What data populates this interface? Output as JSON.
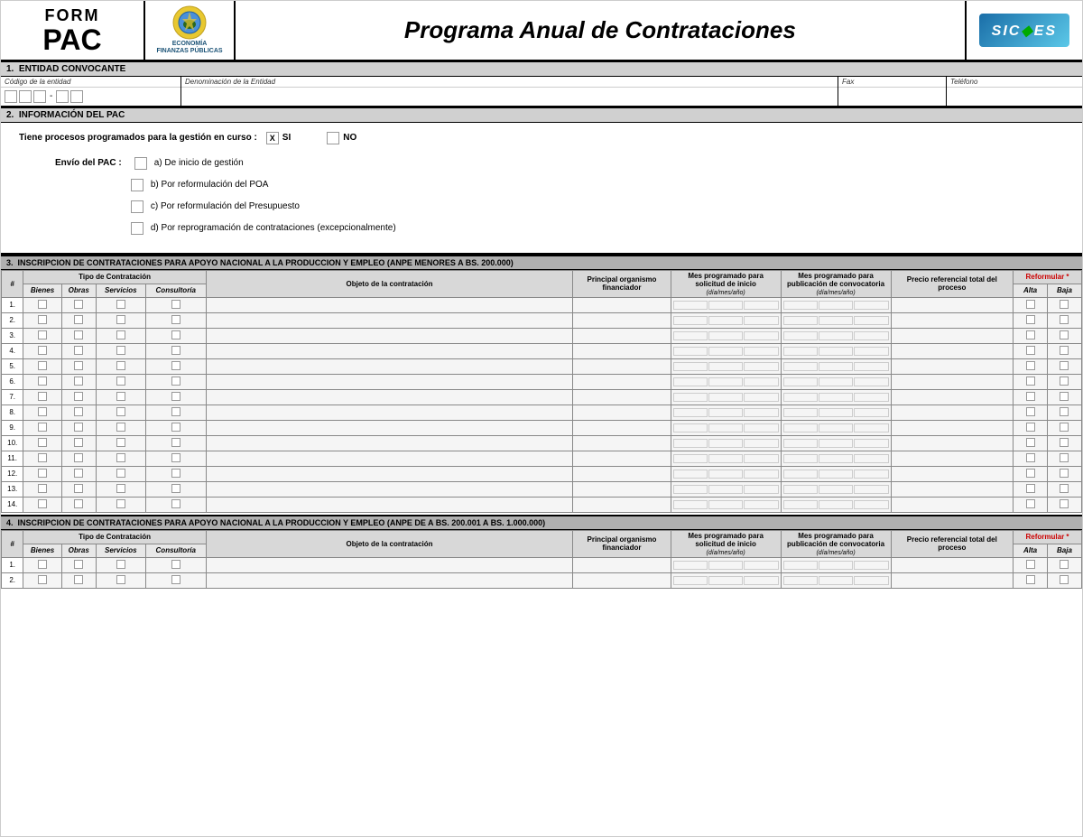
{
  "header": {
    "form_label": "FORM",
    "pac_label": "PAC",
    "ministry_line1": "ECONOMÍA",
    "ministry_line2": "FINANZAS PÚBLICAS",
    "title": "Programa Anual de Contrataciones",
    "sicoes": "SIC◆ES"
  },
  "section1": {
    "number": "1.",
    "title": "ENTIDAD CONVOCANTE",
    "codigo_label": "Código de la entidad",
    "denominacion_label": "Denominación de la Entidad",
    "fax_label": "Fax",
    "telefono_label": "Teléfono"
  },
  "section2": {
    "number": "2.",
    "title": "INFORMACIÓN DEL PAC",
    "question": "Tiene procesos programados para la gestión en curso  :",
    "si_label": "SI",
    "no_label": "NO",
    "si_checked": true,
    "no_checked": false,
    "envio_label": "Envío del PAC :",
    "options": [
      "a)  De inicio de gestión",
      "b)  Por reformulación del POA",
      "c)  Por reformulación del Presupuesto",
      "d)  Por reprogramación de contrataciones (excepcionalmente)"
    ]
  },
  "section3": {
    "number": "3.",
    "title": "INSCRIPCION DE CONTRATACIONES PARA APOYO NACIONAL A LA PRODUCCION Y EMPLEO (ANPE MENORES A BS. 200.000)",
    "tipo_label": "Tipo de Contratación",
    "tipo_sub": [
      "Bienes",
      "Obras",
      "Servicios",
      "Consultoría"
    ],
    "objeto_label": "Objeto de la contratación",
    "organismo_label": "Principal organismo financiador",
    "solicitud_label": "Mes programado para solicitud de inicio",
    "solicitud_sub": "(día/mes/año)",
    "publicacion_label": "Mes programado para publicación de convocatoria",
    "publicacion_sub": "(día/mes/año)",
    "precio_label": "Precio referencial total del proceso",
    "reformular_label": "Reformular *",
    "reformular_sub": [
      "Alta",
      "Baja"
    ],
    "rows": 14
  },
  "section4": {
    "number": "4.",
    "title": "INSCRIPCION DE CONTRATACIONES PARA APOYO NACIONAL A LA PRODUCCION Y EMPLEO (ANPE DE A BS. 200.001 A BS. 1.000.000)",
    "tipo_label": "Tipo de Contratación",
    "tipo_sub": [
      "Bienes",
      "Obras",
      "Servicios",
      "Consultoría"
    ],
    "objeto_label": "Objeto de la contratación",
    "organismo_label": "Principal organismo financiador",
    "solicitud_label": "Mes programado para solicitud de inicio",
    "solicitud_sub": "(día/mes/año)",
    "publicacion_label": "Mes programado para publicación de convocatoria",
    "publicacion_sub": "(día/mes/año)",
    "precio_label": "Precio referencial total del proceso",
    "reformular_label": "Reformular *",
    "reformular_sub": [
      "Alta",
      "Baja"
    ],
    "rows": 2
  }
}
